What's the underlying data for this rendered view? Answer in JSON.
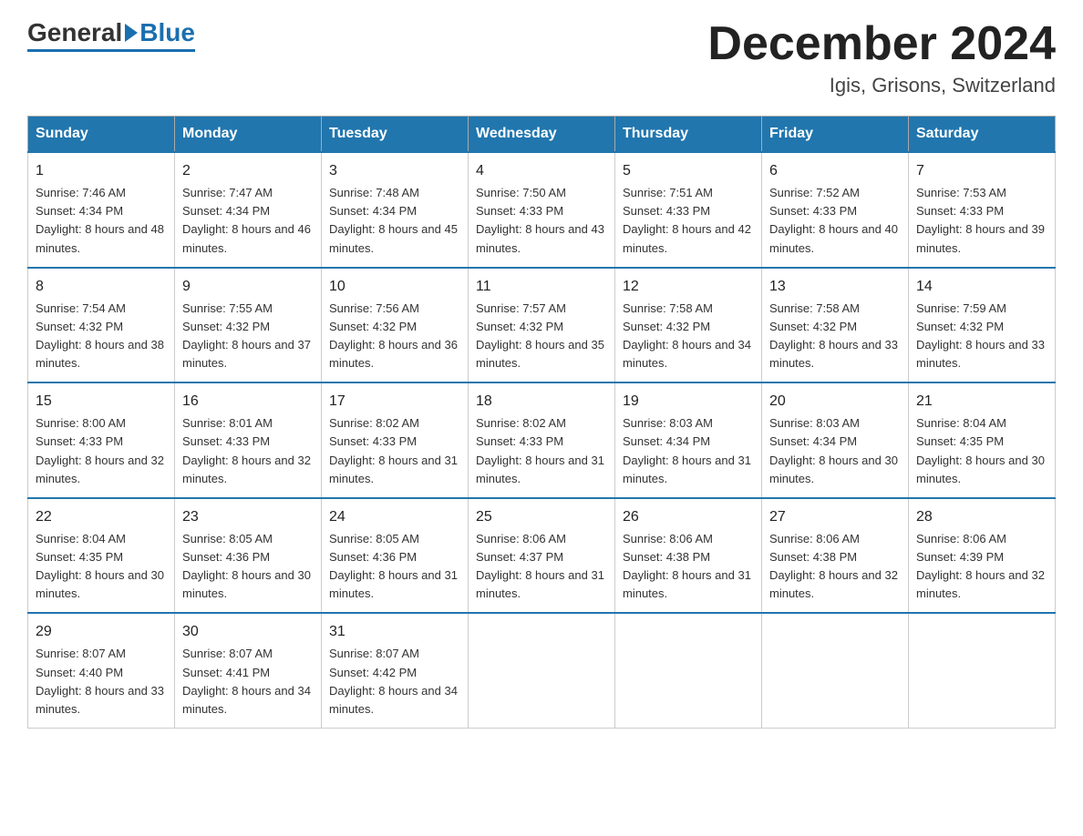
{
  "header": {
    "logo_general": "General",
    "logo_blue": "Blue",
    "month_title": "December 2024",
    "location": "Igis, Grisons, Switzerland"
  },
  "days_of_week": [
    "Sunday",
    "Monday",
    "Tuesday",
    "Wednesday",
    "Thursday",
    "Friday",
    "Saturday"
  ],
  "weeks": [
    [
      {
        "day": "1",
        "sunrise": "7:46 AM",
        "sunset": "4:34 PM",
        "daylight": "8 hours and 48 minutes."
      },
      {
        "day": "2",
        "sunrise": "7:47 AM",
        "sunset": "4:34 PM",
        "daylight": "8 hours and 46 minutes."
      },
      {
        "day": "3",
        "sunrise": "7:48 AM",
        "sunset": "4:34 PM",
        "daylight": "8 hours and 45 minutes."
      },
      {
        "day": "4",
        "sunrise": "7:50 AM",
        "sunset": "4:33 PM",
        "daylight": "8 hours and 43 minutes."
      },
      {
        "day": "5",
        "sunrise": "7:51 AM",
        "sunset": "4:33 PM",
        "daylight": "8 hours and 42 minutes."
      },
      {
        "day": "6",
        "sunrise": "7:52 AM",
        "sunset": "4:33 PM",
        "daylight": "8 hours and 40 minutes."
      },
      {
        "day": "7",
        "sunrise": "7:53 AM",
        "sunset": "4:33 PM",
        "daylight": "8 hours and 39 minutes."
      }
    ],
    [
      {
        "day": "8",
        "sunrise": "7:54 AM",
        "sunset": "4:32 PM",
        "daylight": "8 hours and 38 minutes."
      },
      {
        "day": "9",
        "sunrise": "7:55 AM",
        "sunset": "4:32 PM",
        "daylight": "8 hours and 37 minutes."
      },
      {
        "day": "10",
        "sunrise": "7:56 AM",
        "sunset": "4:32 PM",
        "daylight": "8 hours and 36 minutes."
      },
      {
        "day": "11",
        "sunrise": "7:57 AM",
        "sunset": "4:32 PM",
        "daylight": "8 hours and 35 minutes."
      },
      {
        "day": "12",
        "sunrise": "7:58 AM",
        "sunset": "4:32 PM",
        "daylight": "8 hours and 34 minutes."
      },
      {
        "day": "13",
        "sunrise": "7:58 AM",
        "sunset": "4:32 PM",
        "daylight": "8 hours and 33 minutes."
      },
      {
        "day": "14",
        "sunrise": "7:59 AM",
        "sunset": "4:32 PM",
        "daylight": "8 hours and 33 minutes."
      }
    ],
    [
      {
        "day": "15",
        "sunrise": "8:00 AM",
        "sunset": "4:33 PM",
        "daylight": "8 hours and 32 minutes."
      },
      {
        "day": "16",
        "sunrise": "8:01 AM",
        "sunset": "4:33 PM",
        "daylight": "8 hours and 32 minutes."
      },
      {
        "day": "17",
        "sunrise": "8:02 AM",
        "sunset": "4:33 PM",
        "daylight": "8 hours and 31 minutes."
      },
      {
        "day": "18",
        "sunrise": "8:02 AM",
        "sunset": "4:33 PM",
        "daylight": "8 hours and 31 minutes."
      },
      {
        "day": "19",
        "sunrise": "8:03 AM",
        "sunset": "4:34 PM",
        "daylight": "8 hours and 31 minutes."
      },
      {
        "day": "20",
        "sunrise": "8:03 AM",
        "sunset": "4:34 PM",
        "daylight": "8 hours and 30 minutes."
      },
      {
        "day": "21",
        "sunrise": "8:04 AM",
        "sunset": "4:35 PM",
        "daylight": "8 hours and 30 minutes."
      }
    ],
    [
      {
        "day": "22",
        "sunrise": "8:04 AM",
        "sunset": "4:35 PM",
        "daylight": "8 hours and 30 minutes."
      },
      {
        "day": "23",
        "sunrise": "8:05 AM",
        "sunset": "4:36 PM",
        "daylight": "8 hours and 30 minutes."
      },
      {
        "day": "24",
        "sunrise": "8:05 AM",
        "sunset": "4:36 PM",
        "daylight": "8 hours and 31 minutes."
      },
      {
        "day": "25",
        "sunrise": "8:06 AM",
        "sunset": "4:37 PM",
        "daylight": "8 hours and 31 minutes."
      },
      {
        "day": "26",
        "sunrise": "8:06 AM",
        "sunset": "4:38 PM",
        "daylight": "8 hours and 31 minutes."
      },
      {
        "day": "27",
        "sunrise": "8:06 AM",
        "sunset": "4:38 PM",
        "daylight": "8 hours and 32 minutes."
      },
      {
        "day": "28",
        "sunrise": "8:06 AM",
        "sunset": "4:39 PM",
        "daylight": "8 hours and 32 minutes."
      }
    ],
    [
      {
        "day": "29",
        "sunrise": "8:07 AM",
        "sunset": "4:40 PM",
        "daylight": "8 hours and 33 minutes."
      },
      {
        "day": "30",
        "sunrise": "8:07 AM",
        "sunset": "4:41 PM",
        "daylight": "8 hours and 34 minutes."
      },
      {
        "day": "31",
        "sunrise": "8:07 AM",
        "sunset": "4:42 PM",
        "daylight": "8 hours and 34 minutes."
      },
      null,
      null,
      null,
      null
    ]
  ],
  "accent_color": "#2176ae"
}
